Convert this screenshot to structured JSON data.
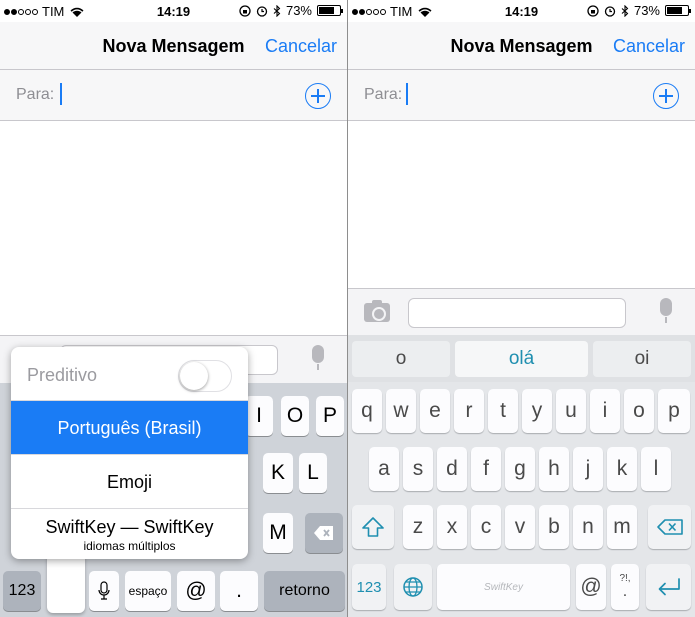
{
  "status": {
    "carrier": "TIM",
    "time": "14:19",
    "battery": "73%"
  },
  "nav": {
    "title": "Nova Mensagem",
    "cancel": "Cancelar"
  },
  "to": {
    "label": "Para:"
  },
  "icons": {
    "add_contact": "plus-circle-icon",
    "camera": "camera-icon",
    "mic": "microphone-icon",
    "shift": "shift-arrow-icon",
    "backspace": "backspace-icon",
    "globe": "globe-icon",
    "return": "return-arrow-icon"
  },
  "colors": {
    "accent": "#1a7cf5",
    "swiftkey_accent": "#1f8fb0"
  },
  "left_keyboard": {
    "visible_keys": [
      "I",
      "O",
      "P",
      "K",
      "L",
      "M"
    ],
    "key_123": "123",
    "space": "espaço",
    "at": "@",
    "dot": ".",
    "return": "retorno"
  },
  "language_popup": {
    "predictive_label": "Preditivo",
    "predictive_on": false,
    "options": [
      "Português (Brasil)",
      "Emoji",
      "SwiftKey — SwiftKey"
    ],
    "selected_index": 0,
    "swiftkey_sublabel": "idiomas múltiplos"
  },
  "swiftkey": {
    "predictions": [
      "o",
      "olá",
      "oi"
    ],
    "row1": [
      "q",
      "w",
      "e",
      "r",
      "t",
      "y",
      "u",
      "i",
      "o",
      "p"
    ],
    "row2": [
      "a",
      "s",
      "d",
      "f",
      "g",
      "h",
      "j",
      "k",
      "l"
    ],
    "row3": [
      "z",
      "x",
      "c",
      "v",
      "b",
      "n",
      "m"
    ],
    "key_123": "123",
    "space_brand": "SwiftKey",
    "at": "@",
    "punct_top": "?!,",
    "punct_main": "."
  }
}
